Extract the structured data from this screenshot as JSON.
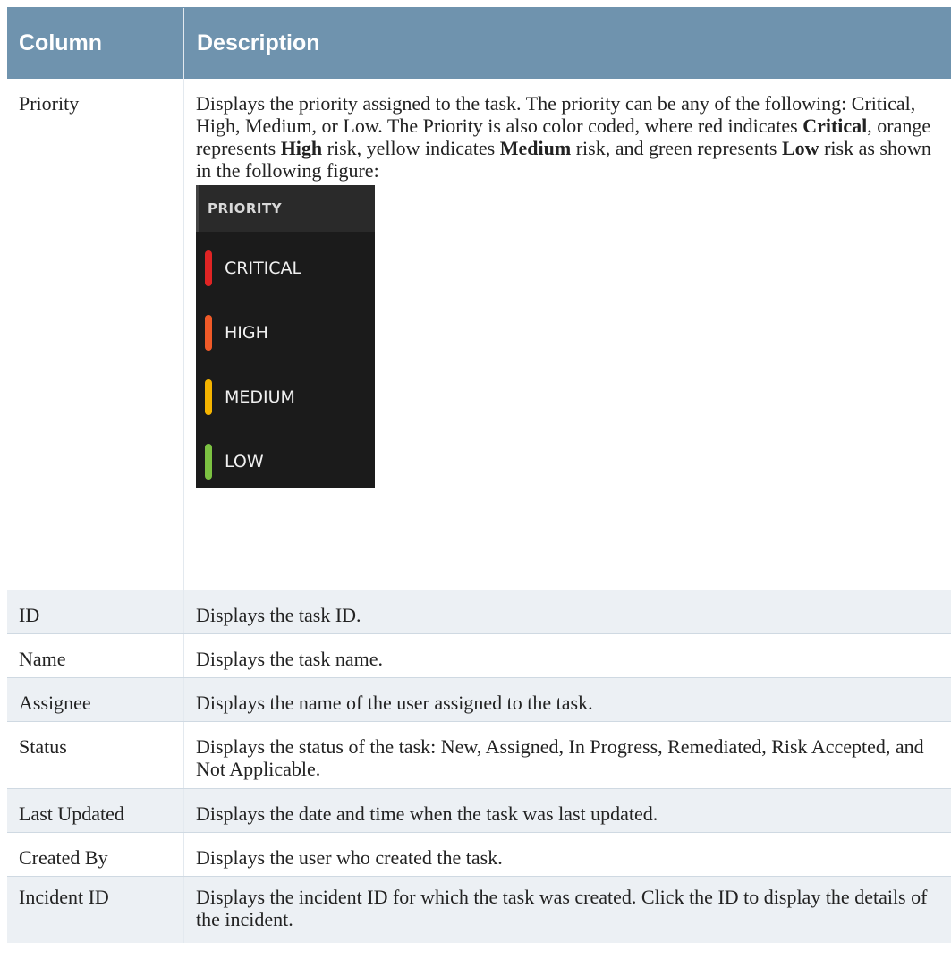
{
  "table": {
    "headers": {
      "column": "Column",
      "description": "Description"
    },
    "priority": {
      "name": "Priority",
      "desc_1": "Displays the priority assigned to the task. The priority can be any of the following: Critical, High, Medium, or Low. The Priority is also color coded, where red indicates ",
      "bold_critical": "Critical",
      "desc_2": ", orange represents ",
      "bold_high": "High",
      "desc_3": " risk, yellow indicates ",
      "bold_medium": "Medium",
      "desc_4": " risk, and green represents ",
      "bold_low": "Low",
      "desc_5": " risk as shown in the following figure:",
      "figure": {
        "header": "PRIORITY",
        "items": [
          {
            "label": "CRITICAL",
            "color": "#e02424"
          },
          {
            "label": "HIGH",
            "color": "#f05a28"
          },
          {
            "label": "MEDIUM",
            "color": "#f5b400"
          },
          {
            "label": "LOW",
            "color": "#7cc242"
          }
        ]
      }
    },
    "rows": [
      {
        "name": "ID",
        "desc": "Displays the task ID."
      },
      {
        "name": "Name",
        "desc": "Displays the task name."
      },
      {
        "name": "Assignee",
        "desc": "Displays the name of the user assigned to the task."
      },
      {
        "name": "Status",
        "desc": "Displays the status of the task: New, Assigned, In Progress, Remediated, Risk Accepted, and Not Applicable."
      },
      {
        "name": "Last Updated",
        "desc": "Displays the date and time when the task was last updated."
      },
      {
        "name": "Created By",
        "desc": "Displays the user who created the task."
      },
      {
        "name": "Incident ID",
        "desc": "Displays the incident ID for which the task was created. Click the ID to display the details of the incident."
      }
    ]
  }
}
